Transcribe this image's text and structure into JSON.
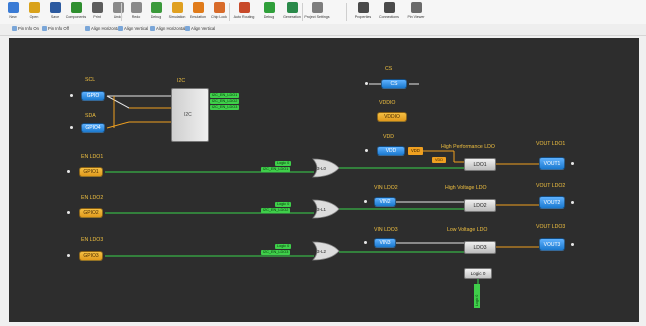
{
  "toolbar": {
    "buttons": [
      {
        "label": "New",
        "icon": "new-file-icon",
        "color": "#3a7bd5"
      },
      {
        "label": "Open",
        "icon": "open-folder-icon",
        "color": "#d9a21b"
      },
      {
        "label": "Save",
        "icon": "save-icon",
        "color": "#2c5aa0"
      },
      {
        "label": "Components",
        "icon": "components-icon",
        "color": "#2f8f2f"
      },
      {
        "label": "Print",
        "icon": "print-icon",
        "color": "#5d5d5d"
      },
      {
        "label": "Undo",
        "icon": "undo-icon",
        "color": "#8a8a8a"
      },
      {
        "label": "Redo",
        "icon": "redo-icon",
        "color": "#8a8a8a"
      },
      {
        "label": "Debug",
        "icon": "debug-icon",
        "color": "#3b9a3b"
      },
      {
        "label": "Simulation",
        "icon": "simulation-icon",
        "color": "#e0a020"
      },
      {
        "label": "Emulation",
        "icon": "emulation-icon",
        "color": "#e07b1a"
      },
      {
        "label": "Chip Lock",
        "icon": "chip-lock-icon",
        "color": "#d86b2a"
      },
      {
        "label": "Auto Routing",
        "icon": "auto-routing-icon",
        "color": "#c84a2a"
      },
      {
        "label": "Debug",
        "icon": "run-icon",
        "color": "#2f9f3a"
      },
      {
        "label": "Generation",
        "icon": "generation-icon",
        "color": "#2a8a4a"
      },
      {
        "label": "Project Settings",
        "icon": "settings-icon",
        "color": "#7d7d7d"
      },
      {
        "label": "Properties",
        "icon": "properties-icon",
        "color": "#4a4a4a"
      },
      {
        "label": "Connections",
        "icon": "connections-icon",
        "color": "#4a4a4a"
      },
      {
        "label": "Pin Viewer",
        "icon": "pin-viewer-icon",
        "color": "#6a6a6a"
      }
    ]
  },
  "subtoolbar": {
    "items": [
      {
        "label": "Pin Info On",
        "icon": "pin-info-icon"
      },
      {
        "label": "Pin Info Off",
        "icon": "pin-info-off-icon"
      },
      {
        "label": "Align Horizontal",
        "icon": "align-horizontal-icon"
      },
      {
        "label": "Align Vertical",
        "icon": "align-vertical-icon"
      },
      {
        "label": "Align Horizontal",
        "icon": "align-horizontal-icon"
      },
      {
        "label": "Align Vertical",
        "icon": "align-vertical-icon"
      }
    ]
  },
  "canvas": {
    "i2c_title": "I2C",
    "i2c_block": "I2C",
    "i2c_outputs": [
      "I2C_EN_LDO1",
      "I2C_EN_LDO2",
      "I2C_EN_LDO3"
    ],
    "scl_label": "SCL",
    "scl_block": "GPIO",
    "sda_label": "SDA",
    "sda_block": "GPIO4",
    "cs_label": "CS",
    "cs_block": "CS",
    "vddio_label": "VDDIO",
    "vddio_block": "VDDIO",
    "vdd_label": "VDD",
    "vdd_block": "VDD",
    "vdd_tag": "VDD",
    "en_ldo1_label": "EN LDO1",
    "en_ldo1_block": "GPIO1",
    "en_ldo2_label": "EN LDO2",
    "en_ldo2_block": "GPIO2",
    "en_ldo3_label": "EN LDO3",
    "en_ldo3_block": "GPIO3",
    "gate1_tags": [
      "Logic 0",
      "I2C_EN_LDO1"
    ],
    "gate1_label": "3-L0",
    "gate2_tags": [
      "Logic 0",
      "I2C_EN_LDO2"
    ],
    "gate2_label": "3-L1",
    "gate3_tags": [
      "Logic 0",
      "I2C_EN_LDO3"
    ],
    "gate3_label": "3-L2",
    "ldo1_title": "High Performance LDO",
    "ldo1_block": "LDO1",
    "ldo1_vdd_tag": "VDD",
    "vin_ldo2_label": "VIN LDO2",
    "vin2_block": "VIN2",
    "ldo2_title": "High Voltage LDO",
    "ldo2_block": "LDO2",
    "vin_ldo3_label": "VIN LDO3",
    "vin3_block": "VIN3",
    "ldo3_title": "Low Voltage LDO",
    "ldo3_block": "LDO3",
    "vout_ldo1_label": "VOUT LDO1",
    "vout1_block": "VOUT1",
    "vout_ldo2_label": "VOUT LDO2",
    "vout2_block": "VOUT2",
    "vout_ldo3_label": "VOUT LDO3",
    "vout3_block": "VOUT3",
    "logic0_block": "Logic 0",
    "logic0_tag": "Logic 0",
    "colors": {
      "canvas": "#2d2d2d",
      "wire_green": "#39d24a",
      "wire_orange": "#f0a020",
      "wire_white": "#e6e6e6"
    }
  }
}
